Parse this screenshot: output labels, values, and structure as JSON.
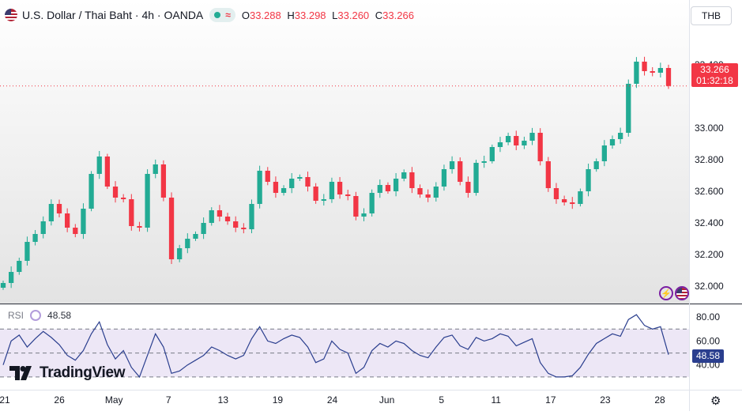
{
  "header": {
    "title": "U.S. Dollar / Thai Baht · 4h · OANDA",
    "o_label": "O",
    "o_value": "33.288",
    "h_label": "H",
    "h_value": "33.298",
    "l_label": "L",
    "l_value": "33.260",
    "c_label": "C",
    "c_value": "33.266",
    "wave_icon": "≈"
  },
  "currency_selector": "THB",
  "last_price": "33.266",
  "countdown": "01:32:18",
  "rsi": {
    "label": "RSI",
    "value": "48.58"
  },
  "brand": "TradingView",
  "icons": [
    "flag-us-icon",
    "live-dot-icon",
    "wave-icon",
    "rsi-settings-icon",
    "lightning-icon",
    "flag-badge-icon",
    "gear-icon"
  ],
  "colors": {
    "up": "#22ab94",
    "down": "#f23645",
    "rsi_line": "#2a3e8e",
    "rsi_band": "#ede7f6",
    "price_line": "#f23645"
  },
  "chart_data": [
    {
      "type": "candlestick",
      "title": "U.S. Dollar / Thai Baht",
      "interval": "4h",
      "source": "OANDA",
      "ylim": [
        31.95,
        33.65
      ],
      "y_ticks": [
        "33.400",
        "33.000",
        "32.800",
        "32.600",
        "32.400",
        "32.200",
        "32.000"
      ],
      "x_ticks": [
        "21",
        "26",
        "May",
        "7",
        "13",
        "19",
        "24",
        "Jun",
        "5",
        "11",
        "17",
        "23",
        "28"
      ],
      "last_close": 33.266,
      "series": [
        {
          "name": "close",
          "x_start_tick": "21",
          "x_end_tick": "28",
          "values": [
            32.02,
            32.09,
            32.16,
            32.28,
            32.33,
            32.41,
            32.52,
            32.46,
            32.37,
            32.33,
            32.49,
            32.71,
            32.82,
            32.63,
            32.56,
            32.55,
            32.38,
            32.37,
            32.71,
            32.77,
            32.56,
            32.17,
            32.24,
            32.3,
            32.33,
            32.4,
            32.48,
            32.44,
            32.41,
            32.37,
            32.36,
            32.52,
            32.73,
            32.66,
            32.59,
            32.62,
            32.68,
            32.69,
            32.63,
            32.54,
            32.55,
            32.66,
            32.58,
            32.57,
            32.44,
            32.46,
            32.59,
            32.64,
            32.6,
            32.68,
            32.72,
            32.62,
            32.58,
            32.56,
            32.63,
            32.74,
            32.79,
            32.66,
            32.59,
            32.78,
            32.79,
            32.88,
            32.91,
            32.95,
            32.89,
            32.92,
            32.97,
            32.79,
            32.62,
            32.55,
            32.53,
            32.52,
            32.6,
            32.74,
            32.79,
            32.89,
            32.93,
            32.97,
            33.28,
            33.42,
            33.36,
            33.35,
            33.38,
            33.266
          ]
        }
      ]
    },
    {
      "type": "line",
      "title": "RSI",
      "ylim": [
        20,
        90
      ],
      "y_ticks": [
        "80.00",
        "60.00",
        "40.00"
      ],
      "x_ticks": [
        "21",
        "26",
        "May",
        "7",
        "13",
        "19",
        "24",
        "Jun",
        "5",
        "11",
        "17",
        "23",
        "28"
      ],
      "bands": [
        70,
        50,
        30
      ],
      "series": [
        {
          "name": "RSI",
          "values": [
            40,
            60,
            65,
            55,
            62,
            68,
            63,
            57,
            48,
            44,
            52,
            66,
            76,
            57,
            45,
            52,
            38,
            30,
            48,
            66,
            55,
            33,
            35,
            40,
            44,
            48,
            55,
            52,
            48,
            45,
            48,
            62,
            72,
            60,
            58,
            62,
            65,
            63,
            55,
            42,
            45,
            60,
            53,
            50,
            33,
            38,
            52,
            58,
            55,
            60,
            58,
            52,
            48,
            46,
            55,
            63,
            65,
            56,
            53,
            63,
            60,
            62,
            66,
            64,
            56,
            59,
            62,
            42,
            33,
            30,
            30,
            31,
            38,
            49,
            58,
            62,
            66,
            64,
            78,
            82,
            73,
            70,
            72,
            48.58
          ]
        }
      ]
    }
  ]
}
